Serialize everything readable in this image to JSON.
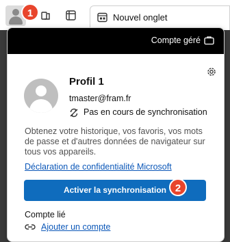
{
  "browser": {
    "new_tab_title": "Nouvel onglet",
    "callouts": [
      "1",
      "2"
    ]
  },
  "profile_panel": {
    "managed_label": "Compte géré",
    "profile_name": "Profil 1",
    "email": "tmaster@fram.fr",
    "sync_status": "Pas en cours de synchronisation",
    "description": "Obtenez votre historique, vos favoris, vos mots de passe et d'autres données de navigateur sur tous vos appareils.",
    "privacy_link": "Déclaration de confidentialité Microsoft",
    "sync_button": "Activer la synchronisation",
    "linked_label": "Compte lié",
    "add_account_link": "Ajouter un compte"
  },
  "colors": {
    "primary_button": "#0f6cbd",
    "link": "#0b57b8",
    "managed_bar": "#000000",
    "callout": "#e8452c"
  },
  "icons": [
    "profile-icon",
    "workspaces-icon",
    "tab-actions-icon",
    "new-tab-page-icon",
    "briefcase-icon",
    "settings-icon",
    "sync-icon",
    "link-icon"
  ]
}
